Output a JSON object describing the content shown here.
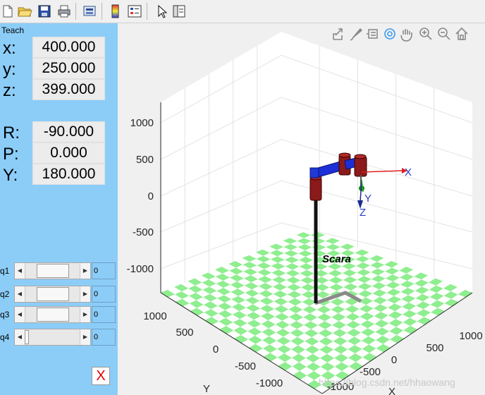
{
  "panel": {
    "title": "Teach",
    "x": {
      "label": "x:",
      "value": "400.000"
    },
    "y": {
      "label": "y:",
      "value": "250.000"
    },
    "z": {
      "label": "z:",
      "value": "399.000"
    },
    "r": {
      "label": "R:",
      "value": "-90.000"
    },
    "p": {
      "label": "P:",
      "value": "0.000"
    },
    "yaw": {
      "label": "Y:",
      "value": "180.000"
    },
    "joints": [
      {
        "label": "q1",
        "value": "0",
        "position": 0.5
      },
      {
        "label": "q2",
        "value": "0",
        "position": 0.5
      },
      {
        "label": "q3",
        "value": "0",
        "position": 0.5
      },
      {
        "label": "q4",
        "value": "0",
        "position": 0.0
      }
    ],
    "close_label": "X"
  },
  "toolbar": {
    "icons": [
      "new-file-icon",
      "open-folder-icon",
      "save-icon",
      "print-icon",
      "print-preview-icon",
      "colorbar-icon",
      "legend-icon",
      "pointer-icon",
      "plot-tools-icon"
    ]
  },
  "axes_toolbar": {
    "icons": [
      "export-icon",
      "brush-icon",
      "data-tips-icon",
      "rotate-3d-icon",
      "pan-icon",
      "zoom-in-icon",
      "zoom-out-icon",
      "home-icon"
    ]
  },
  "plot": {
    "robot_name": "Scara",
    "z_ticks": [
      "1000",
      "500",
      "0",
      "-500",
      "-1000"
    ],
    "y_ticks": [
      "1000",
      "500",
      "0",
      "-500",
      "-1000"
    ],
    "x_ticks": [
      "-1000",
      "-500",
      "0",
      "500",
      "1000"
    ],
    "y_axis_label": "Y",
    "x_axis_label": "X",
    "frame_labels": {
      "x": "X",
      "y": "Y",
      "z": "Z"
    }
  },
  "watermark": "https://blog.csdn.net/hhaowang"
}
